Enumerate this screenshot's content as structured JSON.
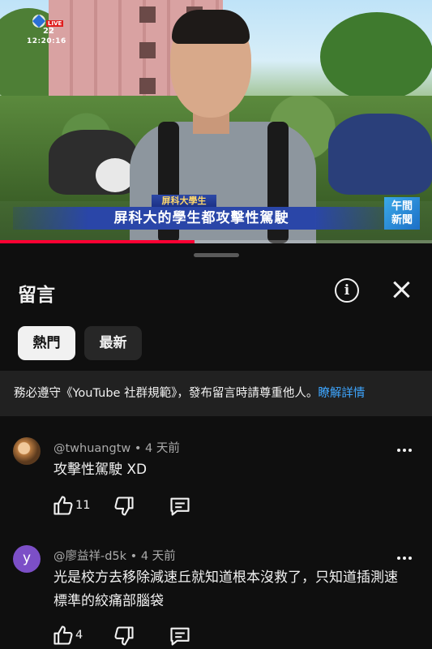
{
  "video": {
    "channel_tag": "LIVE",
    "channel_number": "22",
    "clock": "12:20:16",
    "name_strip": "屏科大學生",
    "caption": "屏科大的學生都攻擊性駕駛",
    "news_logo_line1": "午間",
    "news_logo_line2": "新聞",
    "progress_fraction": 0.45
  },
  "sheet": {
    "title": "留言",
    "info_icon": "info-icon",
    "close_icon": "close-icon",
    "tabs": [
      {
        "label": "熱門",
        "active": true
      },
      {
        "label": "最新",
        "active": false
      }
    ],
    "guideline_text": "務必遵守《YouTube 社群規範》，發布留言時請尊重他人。",
    "guideline_link": "瞭解詳情"
  },
  "comments": [
    {
      "author": "@twhuangtw",
      "time": "4 天前",
      "text": "攻擊性駕駛 XD",
      "likes": "11",
      "avatar_letter": ""
    },
    {
      "author": "@廖益祥-d5k",
      "time": "4 天前",
      "text": "光是校方去移除減速丘就知道根本沒救了，只知道插測速標準的絞痛部腦袋",
      "likes": "4",
      "avatar_letter": "y"
    }
  ],
  "colors": {
    "background": "#0f0f0f",
    "link": "#3ea6ff",
    "progress": "#ff0033",
    "avatar_letter_bg": "#7c4fc7"
  }
}
